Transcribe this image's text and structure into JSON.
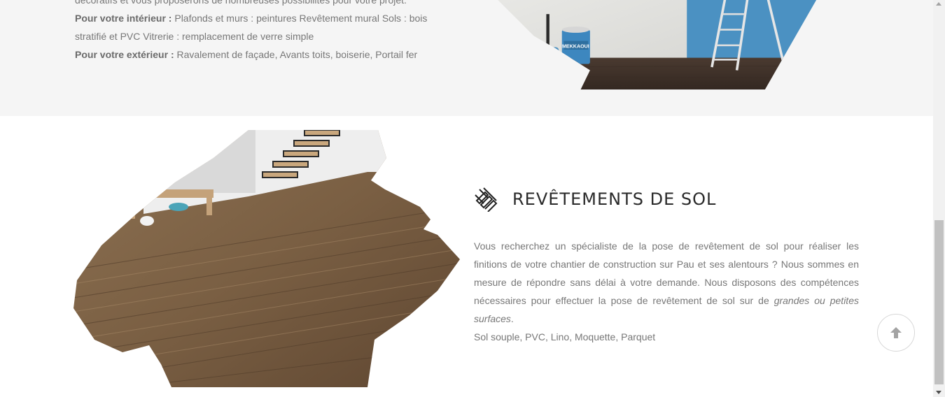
{
  "top_section": {
    "line_cut": "décoratifs et vous proposerons de nombreuses possibilités pour votre projet.",
    "interior_label": "Pour votre intérieur :",
    "interior_text": " Plafonds et murs : peintures Revêtement mural Sols : bois stratifié et PVC Vitrerie : remplacement de verre simple",
    "exterior_label": "Pour votre extérieur :",
    "exterior_text": " Ravalement de façade, Avants toits, boiserie, Portail fer",
    "paint_can_brand": "MEKKAOUI"
  },
  "floor_section": {
    "title": "REVÊTEMENTS DE SOL",
    "icon": "parquet-pattern-icon",
    "paragraph_intro": "Vous recherchez un spécialiste de la pose de revêtement de sol pour réaliser les finitions de votre chantier de construction sur Pau et ses alentours ? Nous sommes en mesure de répondre sans délai à votre demande. Nous disposons des compétences nécessaires pour effectuer la pose de revêtement de sol sur de ",
    "paragraph_emphasis": "grandes ou petites surfaces",
    "paragraph_end": ".",
    "list_line": "Sol souple, PVC, Lino, Moquette, Parquet"
  },
  "controls": {
    "scroll_top_icon": "arrow-up-icon"
  },
  "colors": {
    "section_bg": "#f5f5f5",
    "heading": "#2a2a2a",
    "body_text": "#777777"
  }
}
